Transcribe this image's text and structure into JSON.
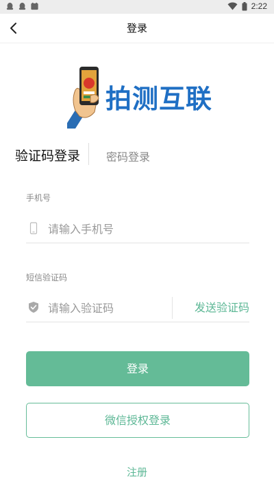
{
  "status_bar": {
    "time": "2:22",
    "left_icons": [
      "qq-icon",
      "qq-icon",
      "notification-icon"
    ],
    "right_icons": [
      "wifi-icon",
      "battery-icon"
    ]
  },
  "header": {
    "title": "登录",
    "back_icon": "chevron-left-icon"
  },
  "logo": {
    "text": "拍测互联"
  },
  "tabs": {
    "sms_login": "验证码登录",
    "password_login": "密码登录",
    "active": "sms_login"
  },
  "form": {
    "phone": {
      "label": "手机号",
      "placeholder": "请输入手机号",
      "value": "",
      "icon": "phone-icon"
    },
    "code": {
      "label": "短信验证码",
      "placeholder": "请输入验证码",
      "value": "",
      "icon": "shield-icon",
      "send_label": "发送验证码"
    }
  },
  "buttons": {
    "login": "登录",
    "wechat_login": "微信授权登录",
    "register": "注册"
  },
  "colors": {
    "accent": "#64bb97",
    "accent_text": "#5cb795",
    "logo_text": "#1f6fc4"
  }
}
